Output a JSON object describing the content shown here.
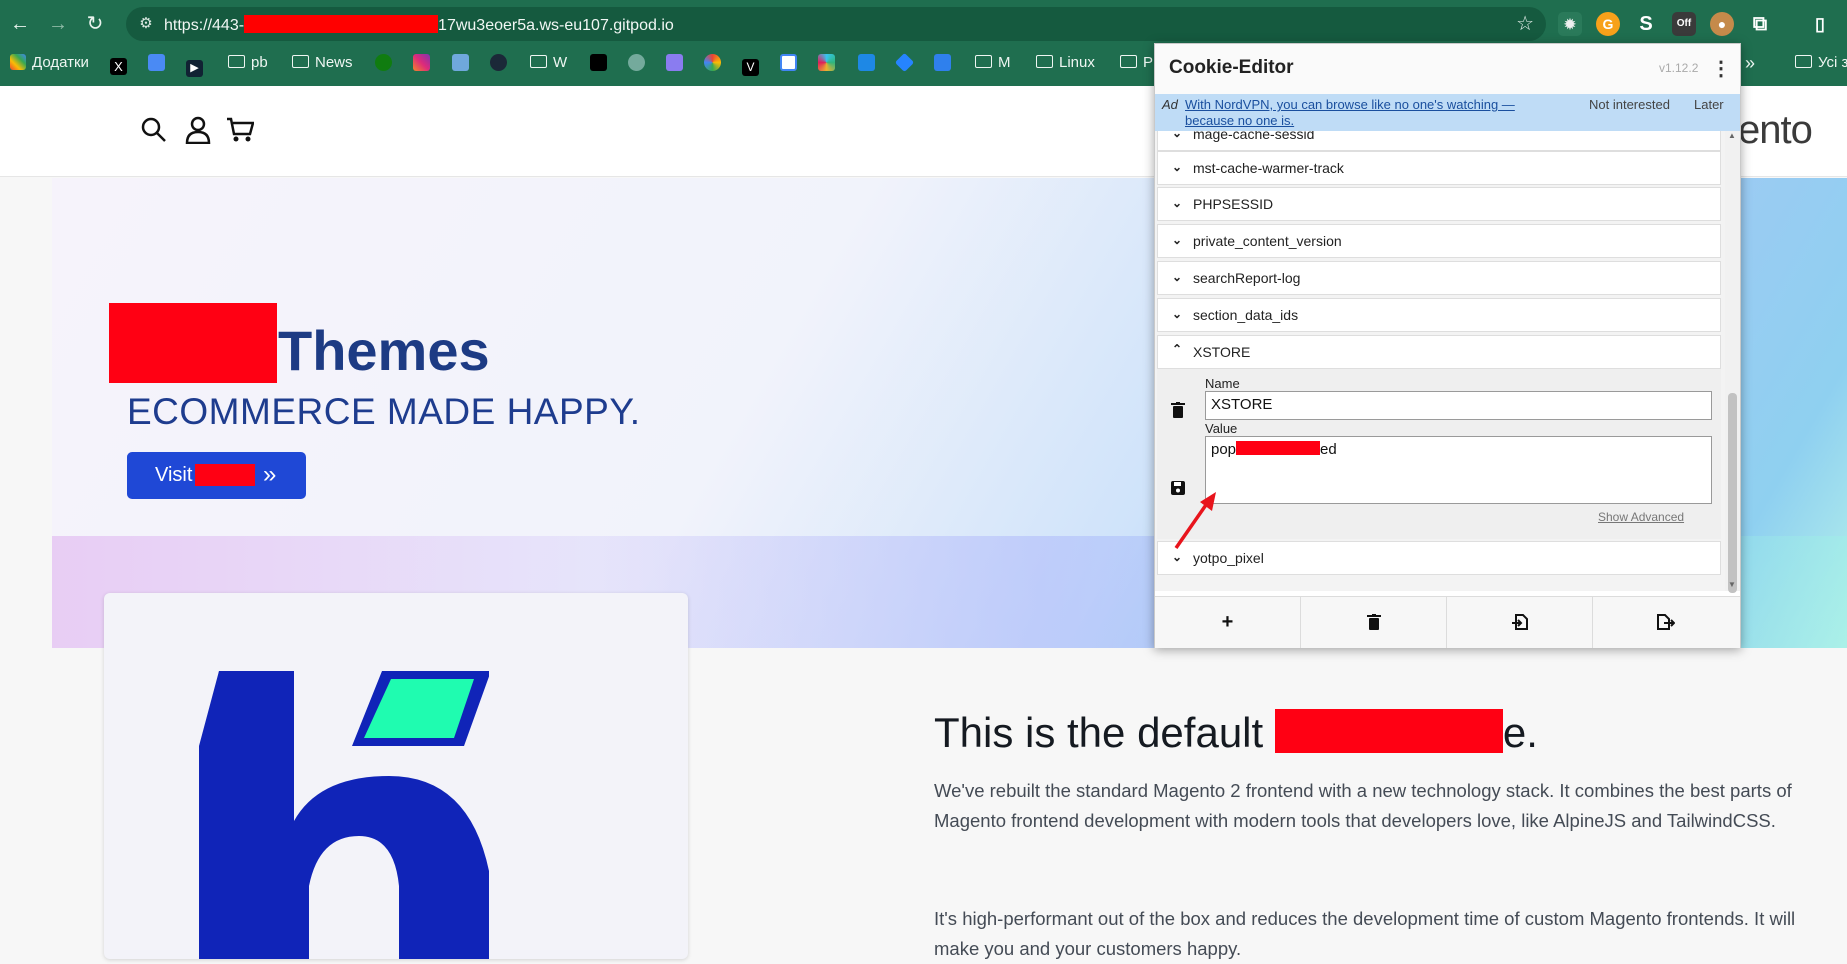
{
  "browser": {
    "url_prefix": "https://443-",
    "url_suffix": "17wu3eoer5a.ws-eu107.gitpod.io",
    "ext_off_label": "Off",
    "bookmarks": {
      "apps": "Додатки",
      "pb": "pb",
      "news": "News",
      "w": "W",
      "m": "M",
      "linux": "Linux",
      "p": "P",
      "more": "»",
      "all": "Усі з"
    }
  },
  "site": {
    "hero_title": "Themes",
    "hero_subtitle": "ECOMMERCE MADE HAPPY.",
    "visit_label": "Visit",
    "visit_arrow": "»",
    "logo_partial": "ento",
    "heading_start": "This is the default",
    "heading_end": "e.",
    "paragraph1": "We've rebuilt the standard Magento 2 frontend with a new technology stack. It combines the best parts of Magento frontend development with modern tools that developers love, like AlpineJS and TailwindCSS.",
    "paragraph2": "It's high-performant out of the box and reduces the development time of custom Magento frontends. It will make you and your customers happy."
  },
  "cookie_editor": {
    "title": "Cookie-Editor",
    "version": "v1.12.2",
    "ad": {
      "label": "Ad",
      "text_line1": "With NordVPN, you can browse like no one's watching —",
      "text_line2": "because no one is.",
      "not_interested": "Not interested",
      "later": "Later"
    },
    "cookies": [
      {
        "name": "mage-cache-sessid",
        "expanded": false
      },
      {
        "name": "mst-cache-warmer-track",
        "expanded": false
      },
      {
        "name": "PHPSESSID",
        "expanded": false
      },
      {
        "name": "private_content_version",
        "expanded": false
      },
      {
        "name": "searchReport-log",
        "expanded": false
      },
      {
        "name": "section_data_ids",
        "expanded": false
      },
      {
        "name": "XSTORE",
        "expanded": true
      },
      {
        "name": "yotpo_pixel",
        "expanded": false
      }
    ],
    "detail": {
      "name_label": "Name",
      "name_value": "XSTORE",
      "value_label": "Value",
      "value_start": "pop",
      "value_end": "ed",
      "show_advanced": "Show Advanced"
    },
    "footer_buttons": [
      "add-cookie",
      "delete-all",
      "import",
      "export"
    ]
  },
  "colors": {
    "chrome": "#1f6e4f",
    "hero_text": "#1d3b84",
    "button": "#1f48d6",
    "redaction": "#ff0013",
    "ad_bg": "#bfdcf6"
  }
}
